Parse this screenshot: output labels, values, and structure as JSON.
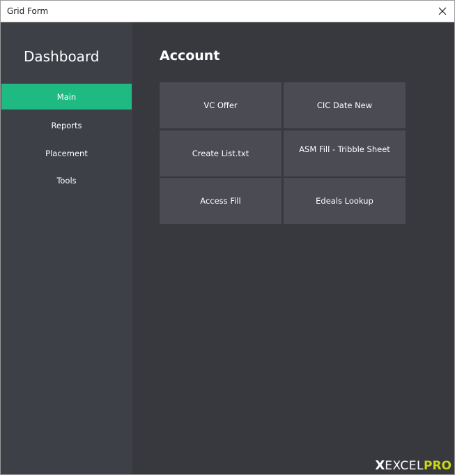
{
  "window": {
    "title": "Grid Form"
  },
  "sidebar": {
    "title": "Dashboard",
    "items": [
      {
        "label": "Main",
        "active": true
      },
      {
        "label": "Reports",
        "active": false
      },
      {
        "label": "Placement",
        "active": false
      },
      {
        "label": "Tools",
        "active": false
      }
    ]
  },
  "main": {
    "section_title": "Account",
    "tiles": [
      {
        "label": "VC Offer"
      },
      {
        "label": "CIC Date New"
      },
      {
        "label": "Create List.txt"
      },
      {
        "label": "ASM Fill - Tribble Sheet"
      },
      {
        "label": "Access Fill"
      },
      {
        "label": "Edeals Lookup"
      }
    ]
  },
  "watermark": {
    "x": "X",
    "excel": "EXCEL",
    "pro": "PRO"
  },
  "colors": {
    "accent": "#1fba82",
    "sidebar_bg": "#3e4048",
    "main_bg": "#38383f",
    "tile_bg": "#4a4b53"
  },
  "icons": {
    "close": "close-icon"
  }
}
